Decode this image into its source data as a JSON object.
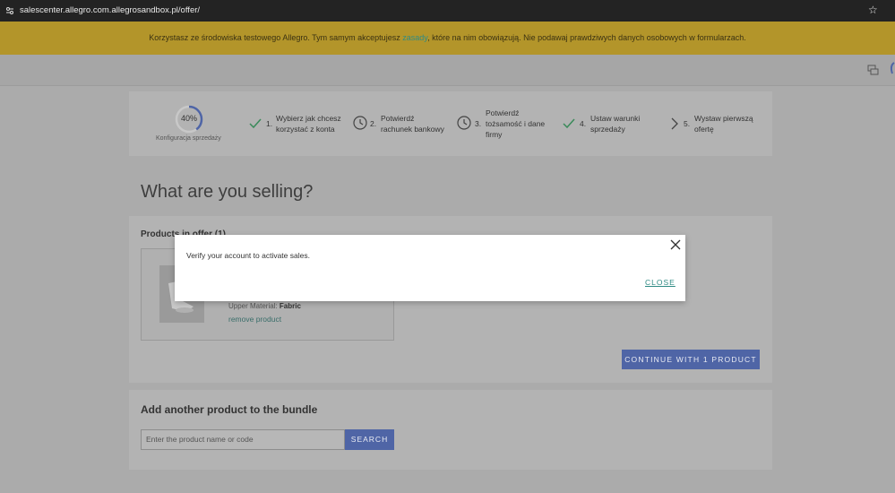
{
  "browser": {
    "url": "salescenter.allegro.com.allegrosandbox.pl/offer/",
    "star_icon": "star-icon",
    "tune_icon": "site-settings-icon"
  },
  "banner": {
    "text_before": "Korzystasz ze środowiska testowego Allegro. Tym samym akceptujesz ",
    "link": "zasady",
    "text_after": ", które na nim obowiązują. Nie podawaj prawdziwych danych osobowych w formularzach.",
    "color": "#b3952a"
  },
  "header": {
    "chat_icon": "chat-icon"
  },
  "progress": {
    "percent_label": "40%",
    "fraction": 0.4,
    "caption": "Konfiguracja sprzedaży",
    "accent": "#4f65a6"
  },
  "steps": [
    {
      "num": "1.",
      "line1": "Wybierz jak chcesz",
      "line2": "korzystać z konta",
      "line3": "",
      "icon": "check-icon"
    },
    {
      "num": "2.",
      "line1": "Potwierdź",
      "line2": "rachunek bankowy",
      "line3": "",
      "icon": "clock-icon"
    },
    {
      "num": "3.",
      "line1": "Potwierdź",
      "line2": "tożsamość i dane",
      "line3": "firmy",
      "icon": "clock-icon"
    },
    {
      "num": "4.",
      "line1": "Ustaw warunki",
      "line2": "sprzedaży",
      "line3": "",
      "icon": "check-icon"
    },
    {
      "num": "5.",
      "line1": "Wystaw pierwszą",
      "line2": "ofertę",
      "line3": "",
      "icon": "chevron-right-icon"
    }
  ],
  "page": {
    "title": "What are you selling?"
  },
  "products": {
    "title": "Products in offer (1)",
    "upper_label": "Upper Material: ",
    "upper_value": "Fabric",
    "remove": "remove product",
    "continue": "CONTINUE WITH 1 PRODUCT"
  },
  "add": {
    "title": "Add another product to the bundle",
    "placeholder": "Enter the product name or code",
    "search": "SEARCH"
  },
  "modal": {
    "message": "Verify your account to activate sales.",
    "close": "CLOSE"
  }
}
